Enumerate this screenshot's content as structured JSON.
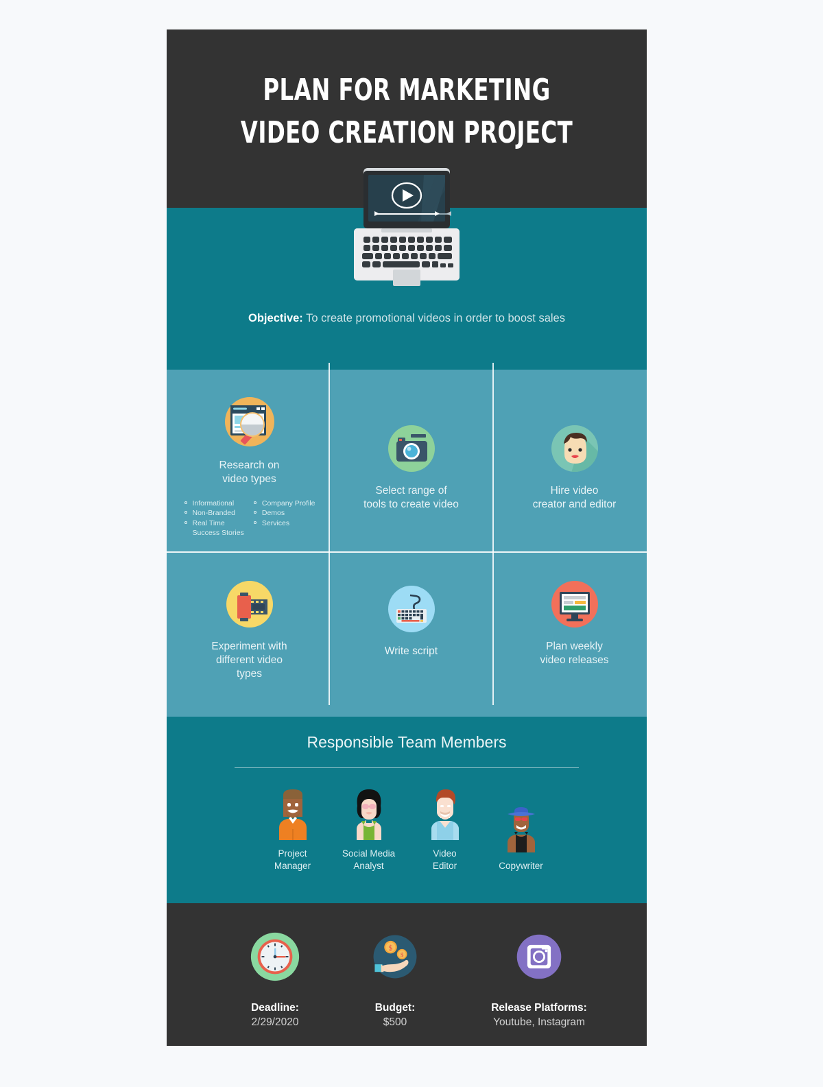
{
  "page": {
    "background": "#f7f9fb",
    "accent_dark": "#333333",
    "accent_teal": "#0d7b8a",
    "accent_light_teal": "#4fa1b5"
  },
  "header": {
    "title_line1": "PLAN FOR MARKETING",
    "title_line2": "VIDEO CREATION PROJECT",
    "hero_icon": "laptop-video-icon"
  },
  "objective": {
    "label": "Objective:",
    "text": "To create promotional videos in order to boost sales"
  },
  "steps": [
    {
      "icon": "research-magnifier-icon",
      "caption_line1": "Research on",
      "caption_line2": "video types",
      "bullets_left": [
        "Informational",
        "Non-Branded",
        "Real Time",
        "Success Stories"
      ],
      "bullets_right": [
        "Company Profile",
        "Demos",
        "Services"
      ]
    },
    {
      "icon": "camera-icon",
      "caption_line1": "Select range of",
      "caption_line2": "tools to create video"
    },
    {
      "icon": "person-face-icon",
      "caption_line1": "Hire video",
      "caption_line2": "creator and editor"
    },
    {
      "icon": "film-roll-icon",
      "caption_line1": "Experiment with",
      "caption_line2": "different video",
      "caption_line3": "types"
    },
    {
      "icon": "keyboard-icon",
      "caption_line1": "Write script",
      "caption_line2": ""
    },
    {
      "icon": "monitor-icon",
      "caption_line1": "Plan weekly",
      "caption_line2": "video releases"
    }
  ],
  "team": {
    "title": "Responsible Team Members",
    "members": [
      {
        "icon": "avatar-project-manager",
        "name_line1": "Project",
        "name_line2": "Manager"
      },
      {
        "icon": "avatar-social-media-analyst",
        "name_line1": "Social Media",
        "name_line2": "Analyst"
      },
      {
        "icon": "avatar-video-editor",
        "name_line1": "Video",
        "name_line2": "Editor"
      },
      {
        "icon": "avatar-copywriter",
        "name_line1": "Copywriter",
        "name_line2": ""
      }
    ]
  },
  "footer": [
    {
      "icon": "clock-icon",
      "label": "Deadline:",
      "value": "2/29/2020"
    },
    {
      "icon": "hand-money-icon",
      "label": "Budget:",
      "value": "$500"
    },
    {
      "icon": "instagram-icon",
      "label": "Release Platforms:",
      "value": "Youtube, Instagram"
    }
  ]
}
